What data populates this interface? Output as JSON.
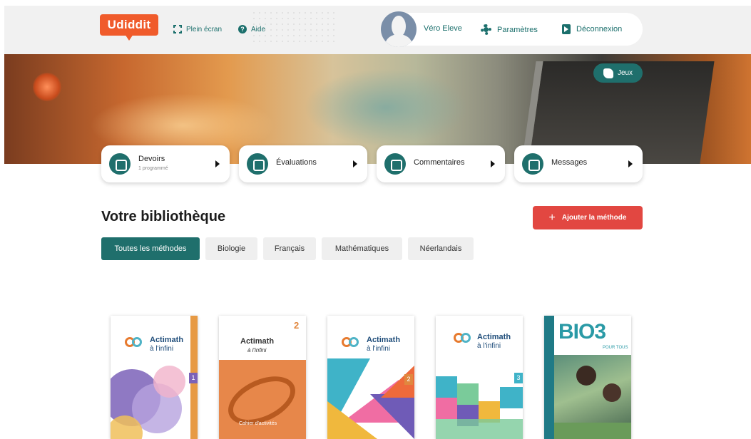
{
  "header": {
    "logo": "Udiddit",
    "fullscreen_label": "Plein écran",
    "help_label": "Aide",
    "user_name": "Véro Eleve",
    "settings_label": "Paramètres",
    "logout_label": "Déconnexion"
  },
  "hero": {
    "games_label": "Jeux"
  },
  "quick_links": [
    {
      "label": "Devoirs",
      "sub": "1 programmé"
    },
    {
      "label": "Évaluations"
    },
    {
      "label": "Commentaires"
    },
    {
      "label": "Messages"
    }
  ],
  "library": {
    "title": "Votre bibliothèque",
    "add_label": "Ajouter la méthode",
    "tabs": [
      "Toutes les méthodes",
      "Biologie",
      "Français",
      "Mathématiques",
      "Néerlandais"
    ],
    "active_tab": "Toutes les méthodes"
  },
  "books": [
    {
      "title": "Actimath",
      "subtitle": "à l'infini",
      "number": "1"
    },
    {
      "title": "Actimath",
      "subtitle": "à l'infini",
      "number": "2",
      "footer": "Cahier d'activités"
    },
    {
      "title": "Actimath",
      "subtitle": "à l'infini",
      "number": "2"
    },
    {
      "title": "Actimath",
      "subtitle": "à l'infini",
      "number": "3"
    },
    {
      "title": "BIO3",
      "subtitle": "POUR TOUS"
    }
  ],
  "colors": {
    "brand_orange": "#f05b2b",
    "teal": "#1f6f6c",
    "red_button": "#e24741"
  }
}
